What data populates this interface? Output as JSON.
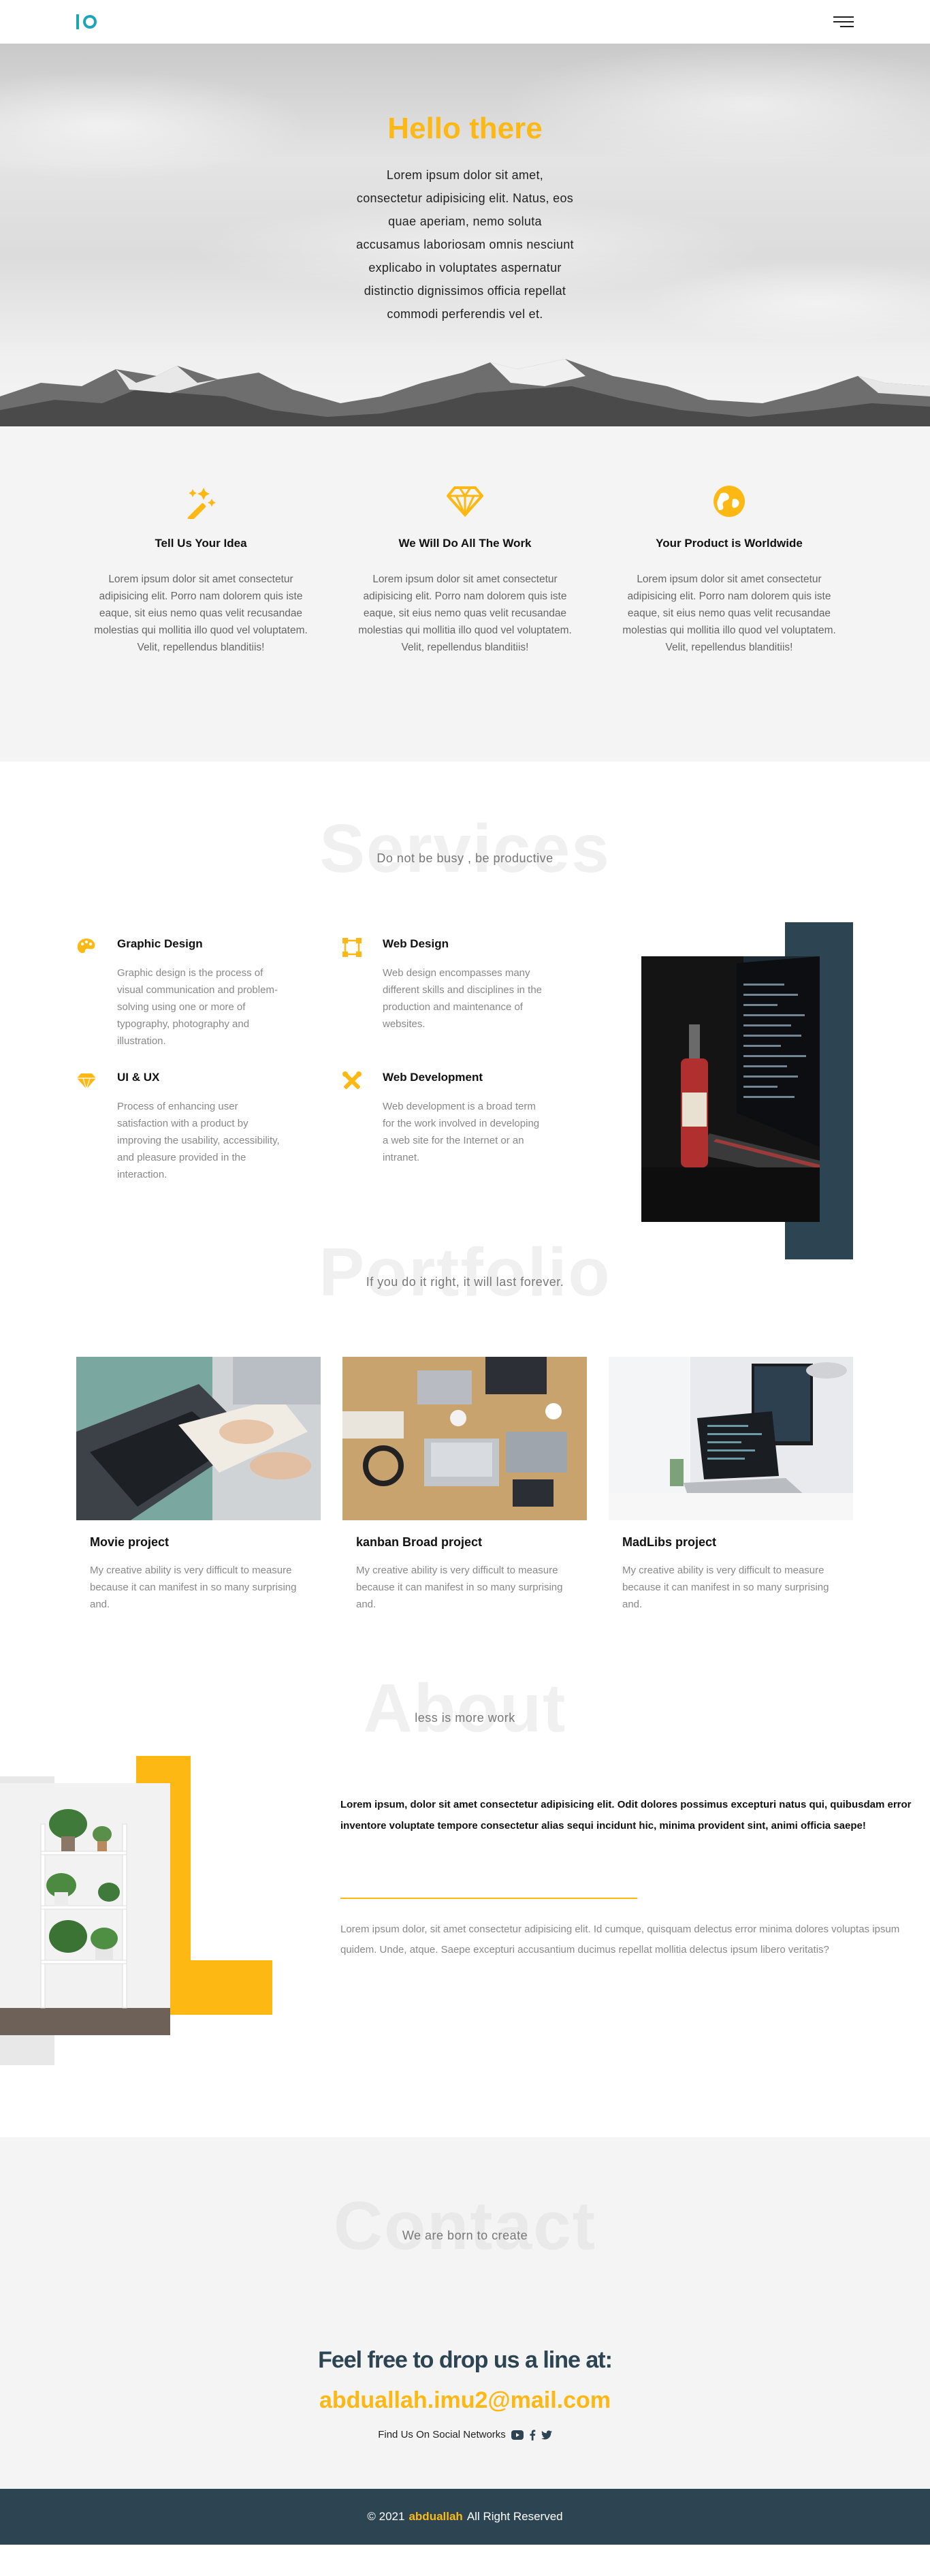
{
  "nav": {
    "logo": "IO",
    "menu_icon": "hamburger-menu-icon"
  },
  "hero": {
    "title": "Hello there",
    "text": "Lorem ipsum dolor sit amet, consectetur adipisicing elit. Natus, eos quae aperiam, nemo soluta accusamus laboriosam omnis nesciunt explicabo in voluptates aspernatur distinctio dignissimos officia repellat commodi perferendis vel et."
  },
  "features": [
    {
      "icon": "magic-wand-icon",
      "title": "Tell Us Your Idea",
      "text": "Lorem ipsum dolor sit amet consectetur adipisicing elit. Porro nam dolorem quis iste eaque, sit eius nemo quas velit recusandae molestias qui mollitia illo quod vel voluptatem. Velit, repellendus blanditiis!"
    },
    {
      "icon": "diamond-icon",
      "title": "We Will Do All The Work",
      "text": "Lorem ipsum dolor sit amet consectetur adipisicing elit. Porro nam dolorem quis iste eaque, sit eius nemo quas velit recusandae molestias qui mollitia illo quod vel voluptatem. Velit, repellendus blanditiis!"
    },
    {
      "icon": "globe-icon",
      "title": "Your Product is Worldwide",
      "text": "Lorem ipsum dolor sit amet consectetur adipisicing elit. Porro nam dolorem quis iste eaque, sit eius nemo quas velit recusandae molestias qui mollitia illo quod vel voluptatem. Velit, repellendus blanditiis!"
    }
  ],
  "services": {
    "heading": "Services",
    "subtitle": "Do not be busy , be productive",
    "items": [
      {
        "icon": "palette-icon",
        "title": "Graphic Design",
        "text": "Graphic design is the process of visual communication and problem-solving using one or more of typography, photography and illustration."
      },
      {
        "icon": "vector-square-icon",
        "title": "Web Design",
        "text": "Web design encompasses many different skills and disciplines in the production and maintenance of websites."
      },
      {
        "icon": "gem-icon",
        "title": "UI & UX",
        "text": "Process of enhancing user satisfaction with a product by improving the usability, accessibility, and pleasure provided in the interaction."
      },
      {
        "icon": "tools-icon",
        "title": "Web Development",
        "text": "Web development is a broad term for the work involved in developing a web site for the Internet or an intranet."
      }
    ]
  },
  "portfolio": {
    "heading": "Portfolio",
    "subtitle": "If you do it right, it will last forever.",
    "items": [
      {
        "title": "Movie project",
        "text": "My creative ability is very difficult to measure because it can manifest in so many surprising and."
      },
      {
        "title": "kanban Broad project",
        "text": "My creative ability is very difficult to measure because it can manifest in so many surprising and."
      },
      {
        "title": "MadLibs project",
        "text": "My creative ability is very difficult to measure because it can manifest in so many surprising and."
      }
    ]
  },
  "about": {
    "heading": "About",
    "subtitle": "less is more work",
    "bold_text": "Lorem ipsum, dolor sit amet consectetur adipisicing elit. Odit dolores possimus excepturi natus qui, quibusdam error inventore voluptate tempore consectetur alias sequi incidunt hic, minima provident sint, animi officia saepe!",
    "text": "Lorem ipsum dolor, sit amet consectetur adipisicing elit. Id cumque, quisquam delectus error minima dolores voluptas ipsum quidem. Unde, atque. Saepe excepturi accusantium ducimus repellat mollitia delectus ipsum libero veritatis?"
  },
  "contact": {
    "heading": "Contact",
    "subtitle": "We are born to create",
    "line": "Feel free to drop us a line at:",
    "email": "abduallah.imu2@mail.com",
    "social_label": "Find Us On Social Networks",
    "social_icons": [
      "youtube-icon",
      "facebook-icon",
      "twitter-icon"
    ]
  },
  "footer": {
    "prefix": "© 2021",
    "brand": "abduallah",
    "suffix": "All Right Reserved"
  },
  "colors": {
    "accent": "#fdb813",
    "dark": "#2d4452",
    "teal": "#1aa6b7"
  }
}
